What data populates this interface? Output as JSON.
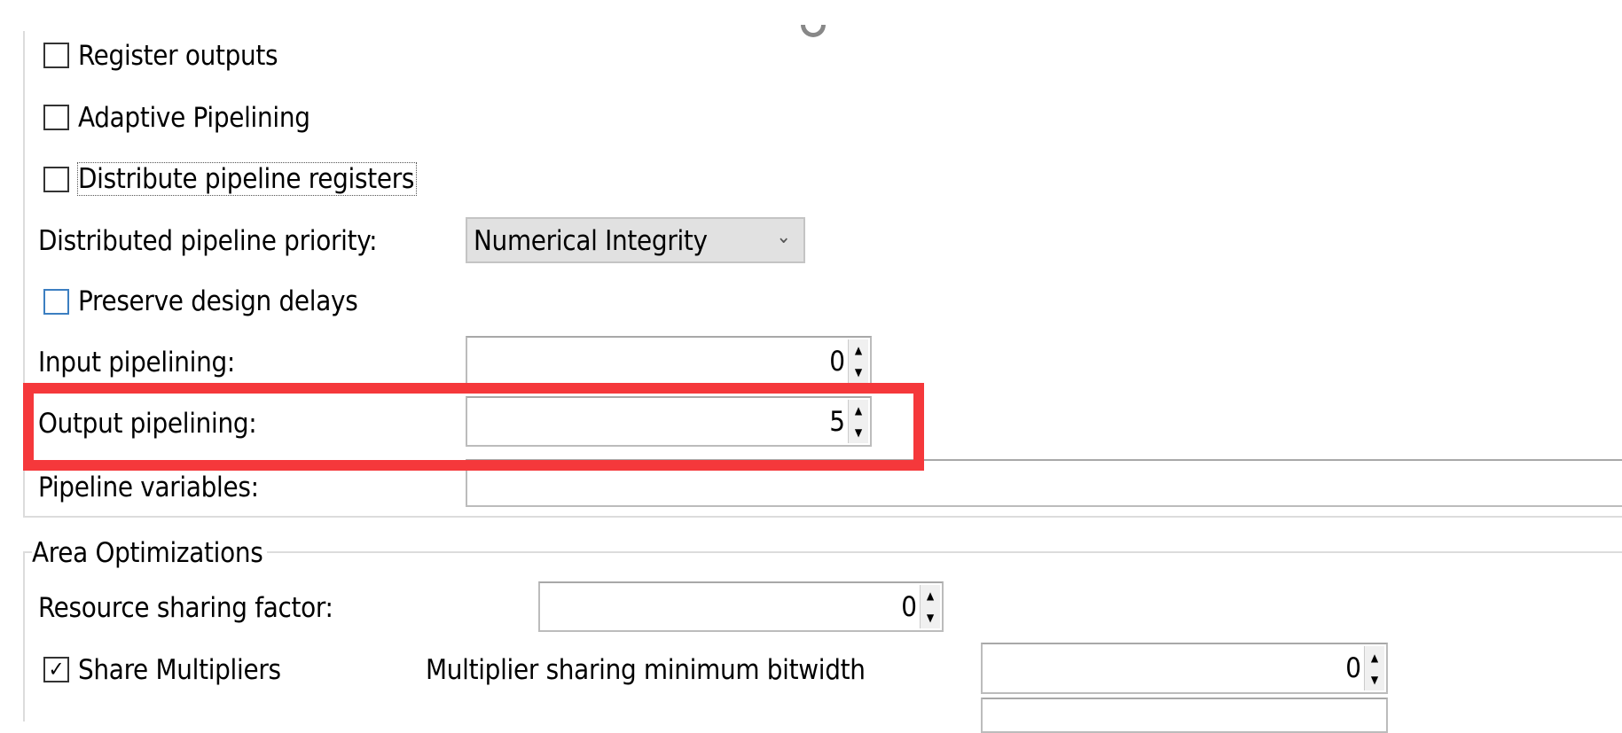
{
  "pipelining": {
    "register_outputs": {
      "label": "Register outputs",
      "checked": false
    },
    "adaptive_pipelining": {
      "label": "Adaptive Pipelining",
      "checked": false
    },
    "distribute_registers": {
      "label": "Distribute pipeline registers",
      "checked": false
    },
    "distributed_priority": {
      "label": "Distributed pipeline priority:",
      "value": "Numerical Integrity"
    },
    "preserve_delays": {
      "label": "Preserve design delays",
      "checked": false
    },
    "input_pipelining": {
      "label": "Input pipelining:",
      "value": "0"
    },
    "output_pipelining": {
      "label": "Output pipelining:",
      "value": "5"
    },
    "pipeline_variables": {
      "label": "Pipeline variables:",
      "value": ""
    }
  },
  "area": {
    "title": "Area Optimizations",
    "resource_sharing": {
      "label": "Resource sharing factor:",
      "value": "0"
    },
    "share_multipliers": {
      "label": "Share Multipliers",
      "checked": true
    },
    "mult_min_bitwidth": {
      "label": "Multiplier sharing minimum bitwidth",
      "value": "0"
    }
  },
  "icons": {
    "checkmark": "✓",
    "spin_up": "▲",
    "spin_down": "▼",
    "dropdown": "⌄"
  },
  "colors": {
    "highlight": "#f5383b",
    "checkbox_focus": "#3c7fc1"
  }
}
